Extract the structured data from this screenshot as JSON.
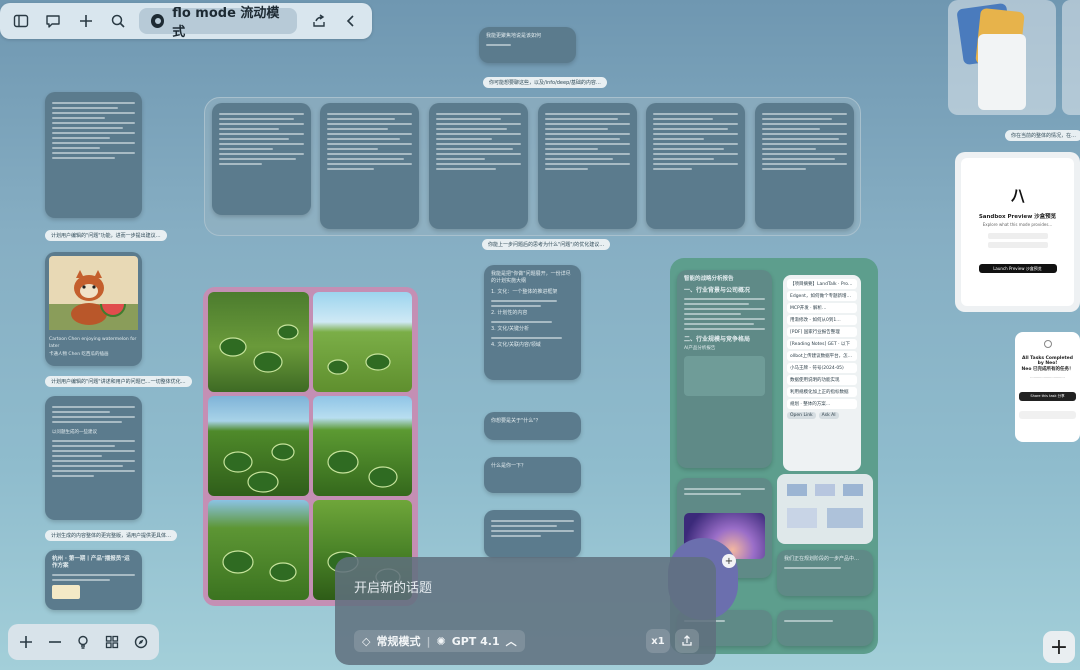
{
  "toolbar": {
    "mode_label": "flo mode 流动模式",
    "icons": [
      "sidebar-icon",
      "chat-icon",
      "plus-icon",
      "search-icon",
      "mode-icon",
      "share-icon",
      "chevron-left-icon"
    ]
  },
  "canvas": {
    "top_card_title": "我能更聚焦地说是该如何",
    "top_label": "你可能想要聊这些，以及/info/deep/基础的内容…",
    "upper_left_chip": "计划用户编辑的\"问题\"功能，进而一步提出建议…",
    "mid_chip": "你能上一步问题后的思考为什么\"问题\"/的优化建议…",
    "panda_caption": "Cartoon Chen enjoying watermelon for later",
    "panda_subcaption": "卡通人物 Chen 吃西瓜的插画",
    "left_chip_2": "计划用户编辑的\"问题\"讲述和用户的问题已…一切整体优化…",
    "left_chip_3": "以问题生成的一些建议",
    "left_chip_4": "计划生成的内容整体的更完整版，请用户提供更具体…",
    "left_bottom_title": "杭州 · 第一期丨产品\"播报员\"运作方案",
    "plan_card_title": "我能是把\"你做\"问题展开，一份详尽的计划实施大纲",
    "plan_sections": [
      "1. 文化：一个整体的推进框架",
      "2. 计划性的内容",
      "3. 文化/关键分析",
      "4. 文化/关联内容/领域"
    ],
    "small_card_1": "你想要是关于\"什么\"？",
    "small_card_2": "什么是你一下？",
    "right_group_title": "智能的战略分析报告",
    "right_group_h1": "一、行业背景与公司概况",
    "right_group_h2": "二、行业规模与竞争格局",
    "right_sub_label": "AI产品分析报告",
    "right_bottom_card": "我们正在规划阶段的一步产品中…",
    "list_items": [
      "【项目摘要】LandTalk · Producer · 如何…",
      "Edgent，如何做个专题新增产…",
      "MCP开发 · 解析…",
      "用渐修改 - 如何从0到1…",
      "[PDF] 国家行业报告整理",
      "[Reading Notes] GET · 以下",
      "ollbot上传建议数据平台，怎样…",
      "小马王牌 - 符号(2024-05)",
      "数据使用说明的功能实现",
      "利用规模化加上正的指标数据",
      "规划 · 整体的方案…"
    ],
    "list_button_1": "Open Link",
    "list_button_2": "Ask AI"
  },
  "right": {
    "sandbox_title": "Sandbox Preview 沙盒预览",
    "sandbox_sub": "Explore what this mode provides...",
    "sandbox_button": "Launch Preview 沙盒预览",
    "tasks_title": "All Tasks Completed by Neo!",
    "tasks_sub": "Neo 已完成所有的任务！",
    "tasks_button": "Share this task 分享",
    "chip": "你在当前的整体的情况，在…"
  },
  "composer": {
    "placeholder": "开启新的话题",
    "mode_pill": "常规模式",
    "model_pill": "GPT 4.1",
    "multiplier": "x1"
  },
  "tools": {
    "icons": [
      "plus-icon",
      "minus-icon",
      "lightbulb-icon",
      "grid-icon",
      "compass-icon"
    ]
  },
  "colors": {
    "accent_card": "#5b7b8d",
    "image_group": "#c48fb4",
    "right_group": "#5d9e8d"
  }
}
